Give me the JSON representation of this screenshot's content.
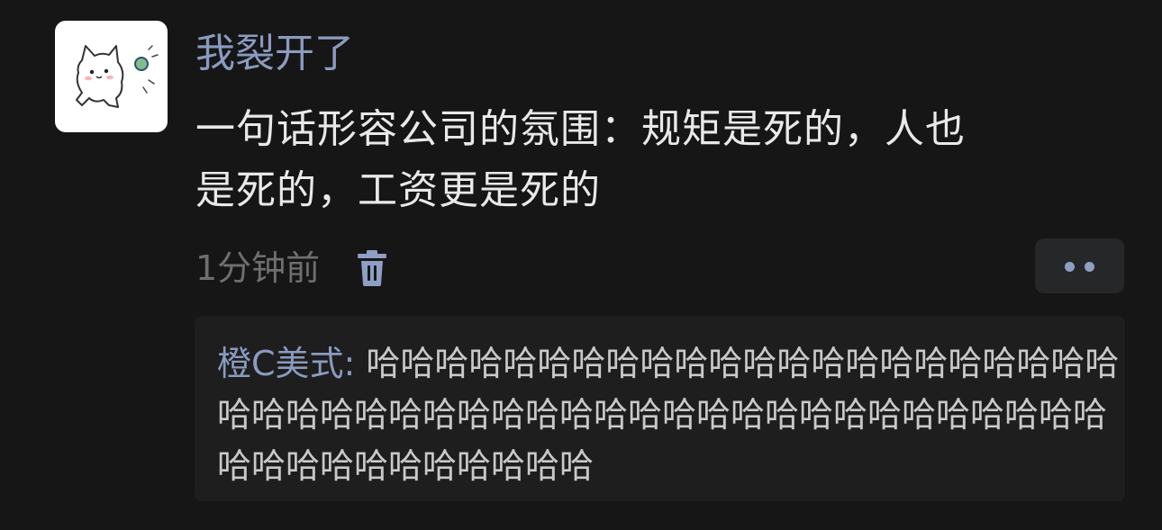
{
  "post": {
    "username": "我裂开了",
    "content_lines": [
      "一句话形容公司的氛围：规矩是死的，人也",
      "是死的，工资更是死的"
    ],
    "timestamp": "1分钟前"
  },
  "comment": {
    "author": "橙C美式:",
    "text": " 哈哈哈哈哈哈哈哈哈哈哈哈哈哈哈哈哈哈哈哈哈哈哈哈哈哈哈哈哈哈哈哈哈哈哈哈哈哈哈哈哈哈哈哈哈哈哈哈哈哈哈哈哈哈哈哈哈哈哈"
  },
  "icons": {
    "avatar": "cartoon-cat-avatar",
    "delete": "trash-icon",
    "more": "more-dots-icon"
  },
  "colors": {
    "background": "#161616",
    "username": "#8b9bc0",
    "accent_dots": "#8e9fc4",
    "comment_bg": "#1e1e1e"
  }
}
